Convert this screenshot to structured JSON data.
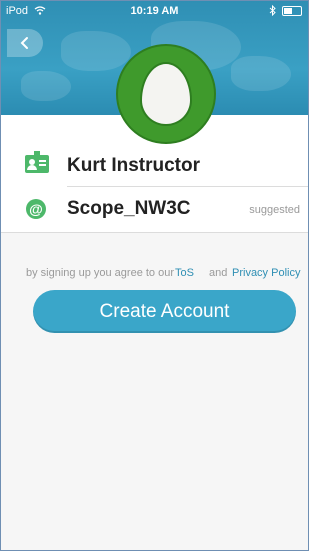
{
  "status_bar": {
    "carrier": "iPod",
    "time": "10:19 AM",
    "bluetooth_icon": "bluetooth-icon",
    "wifi_icon": "wifi-icon",
    "battery_icon": "battery-icon"
  },
  "header": {
    "back_icon": "chevron-left-icon",
    "avatar_icon": "egg-avatar-icon",
    "background_color": "#2f8fb4",
    "avatar_color": "#3f9a2c"
  },
  "form": {
    "name": {
      "icon": "id-card-icon",
      "value": "Kurt Instructor"
    },
    "username": {
      "icon": "at-sign-icon",
      "value": "Scope_NW3C",
      "badge": "suggested"
    }
  },
  "terms": {
    "prefix": "by signing up you agree to our",
    "tos_link": "ToS",
    "conjunction": "and",
    "privacy_link": "Privacy Policy",
    "link_color": "#2f8fb4"
  },
  "actions": {
    "create_account_label": "Create Account",
    "button_color": "#3aa6c9"
  }
}
